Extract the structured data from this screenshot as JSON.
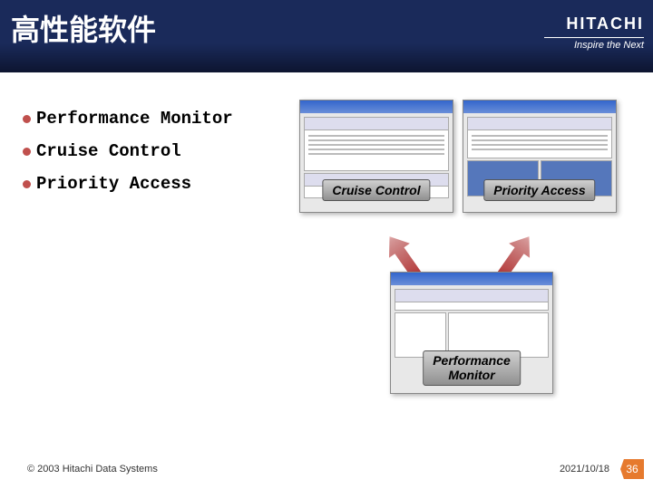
{
  "header": {
    "title": "高性能软件",
    "logo": {
      "name": "HITACHI",
      "tagline": "Inspire the Next"
    }
  },
  "bullets": [
    {
      "text": "Performance Monitor"
    },
    {
      "text": "Cruise Control"
    },
    {
      "text": "Priority Access"
    }
  ],
  "thumbs": {
    "top_left": {
      "label": "Cruise Control"
    },
    "top_right": {
      "label": "Priority Access"
    },
    "bottom": {
      "label_line1": "Performance",
      "label_line2": "Monitor"
    }
  },
  "footer": {
    "copyright": "© 2003 Hitachi Data Systems",
    "date": "2021/10/18",
    "page": "36"
  }
}
